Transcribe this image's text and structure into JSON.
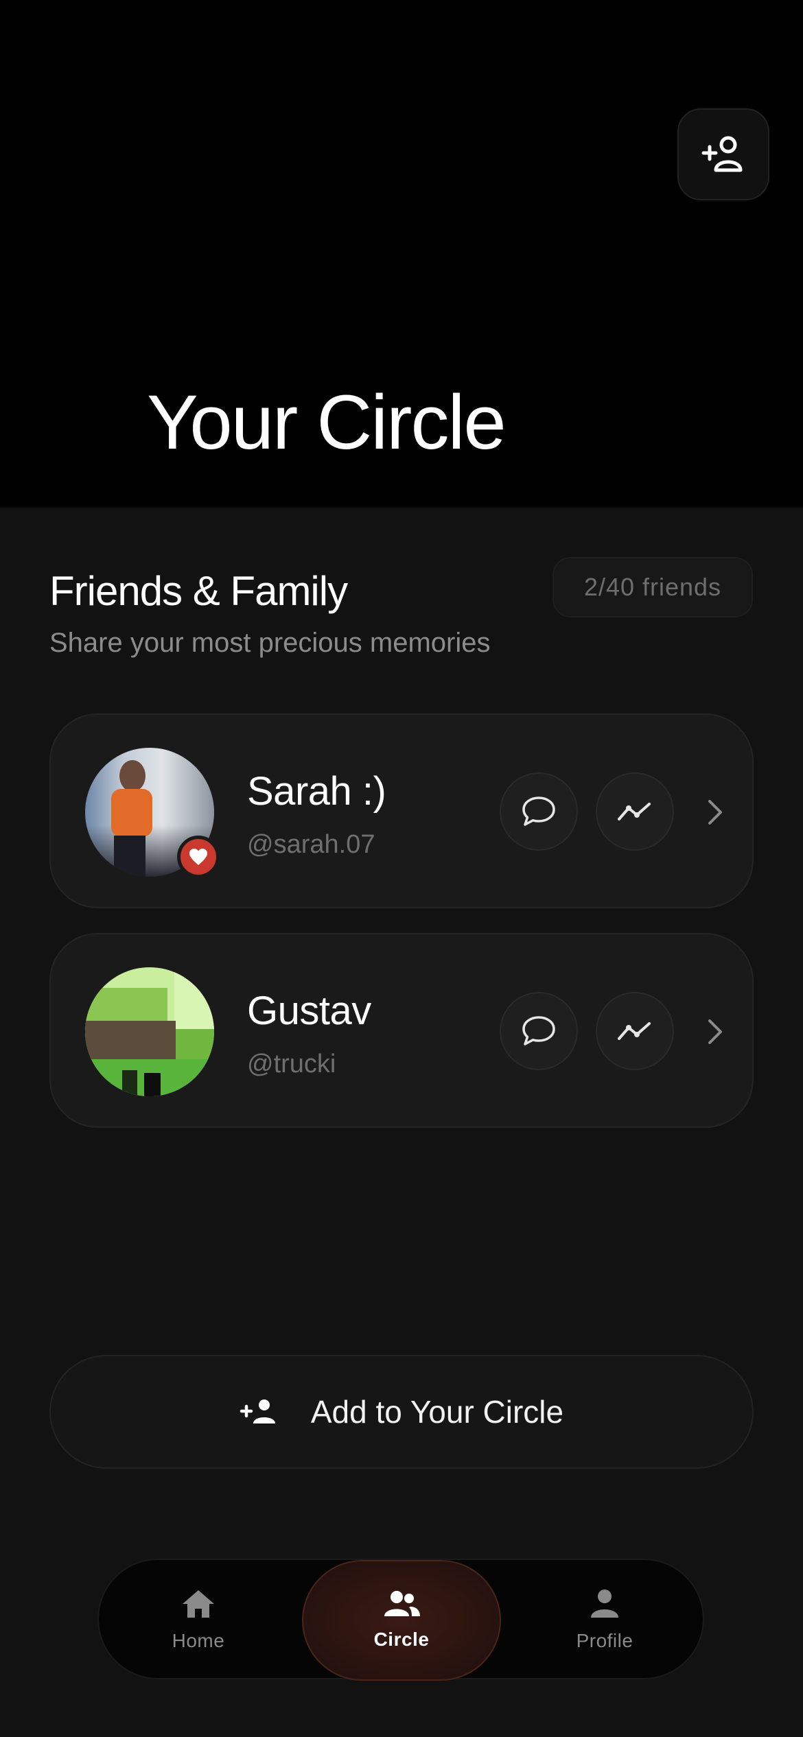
{
  "header": {
    "title": "Your Circle"
  },
  "section": {
    "title": "Friends & Family",
    "subtitle": "Share your most precious memories",
    "count_badge": "2/40 friends"
  },
  "friends": [
    {
      "name": "Sarah :)",
      "handle": "@sarah.07",
      "favorite": true
    },
    {
      "name": "Gustav",
      "handle": "@trucki",
      "favorite": false
    }
  ],
  "add_button": {
    "label": "Add to Your Circle"
  },
  "nav": {
    "items": [
      {
        "label": "Home",
        "icon": "home-icon",
        "active": false
      },
      {
        "label": "Circle",
        "icon": "group-icon",
        "active": true
      },
      {
        "label": "Profile",
        "icon": "person-icon",
        "active": false
      }
    ]
  },
  "colors": {
    "background": "#121212",
    "header": "#000000",
    "card": "#1a1a1a",
    "accent": "#c9392e",
    "active_nav": "#2a1410"
  }
}
